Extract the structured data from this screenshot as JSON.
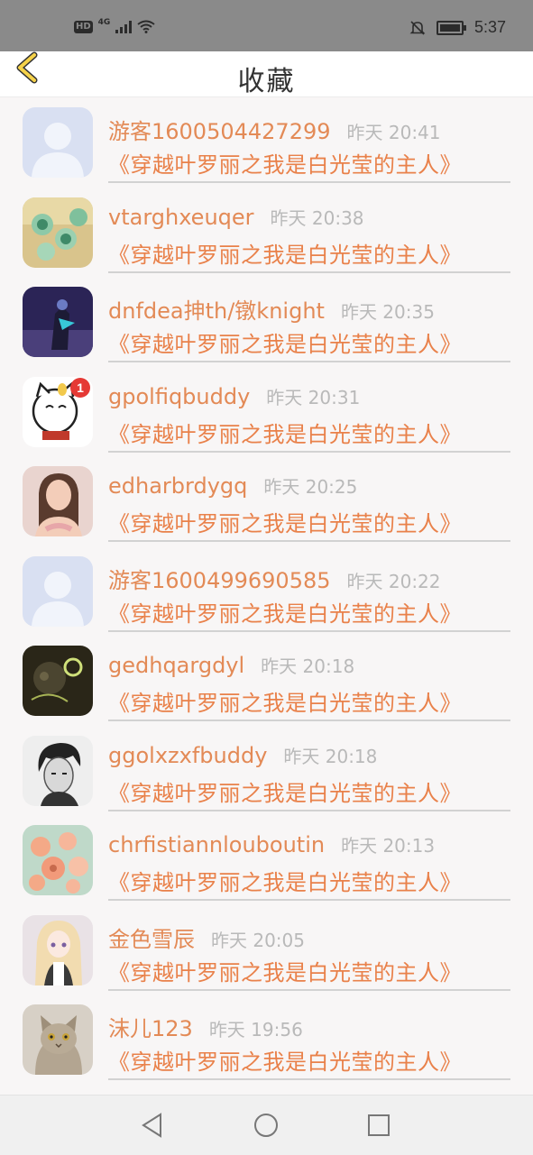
{
  "status_bar": {
    "hd": "HD",
    "signal": "4G",
    "time": "5:37",
    "battery_level": 0.85
  },
  "header": {
    "title": "收藏",
    "back_icon": "chevron-left-icon"
  },
  "favorites": [
    {
      "username": "游客1600504427299",
      "time": "昨天 20:41",
      "book": "《穿越叶罗丽之我是白光莹的主人》",
      "avatar": "default-avatar"
    },
    {
      "username": "vtarghxeuqer",
      "time": "昨天 20:38",
      "book": "《穿越叶罗丽之我是白光莹的主人》",
      "avatar": "cakes-avatar"
    },
    {
      "username": "dnfdea抻th/镦knight",
      "time": "昨天 20:35",
      "book": "《穿越叶罗丽之我是白光莹的主人》",
      "avatar": "knight-avatar"
    },
    {
      "username": "gpolfiqbuddy",
      "time": "昨天 20:31",
      "book": "《穿越叶罗丽之我是白光莹的主人》",
      "avatar": "lucky-cat-avatar"
    },
    {
      "username": "edharbrdygq",
      "time": "昨天 20:25",
      "book": "《穿越叶罗丽之我是白光莹的主人》",
      "avatar": "woman-avatar"
    },
    {
      "username": "游客1600499690585",
      "time": "昨天 20:22",
      "book": "《穿越叶罗丽之我是白光莹的主人》",
      "avatar": "default-avatar"
    },
    {
      "username": "gedhqargdyl",
      "time": "昨天 20:18",
      "book": "《穿越叶罗丽之我是白光莹的主人》",
      "avatar": "dark-photo-avatar"
    },
    {
      "username": "ggolxzxfbuddy",
      "time": "昨天 20:18",
      "book": "《穿越叶罗丽之我是白光莹的主人》",
      "avatar": "man-sketch-avatar"
    },
    {
      "username": "chrfistiannlouboutin",
      "time": "昨天 20:13",
      "book": "《穿越叶罗丽之我是白光莹的主人》",
      "avatar": "flowers-avatar"
    },
    {
      "username": "金色雪辰",
      "time": "昨天 20:05",
      "book": "《穿越叶罗丽之我是白光莹的主人》",
      "avatar": "anime-girl-avatar"
    },
    {
      "username": "沫儿123",
      "time": "昨天 19:56",
      "book": "《穿越叶罗丽之我是白光莹的主人》",
      "avatar": "cat-avatar"
    }
  ],
  "navbar": {
    "back": "triangle-back-icon",
    "home": "circle-home-icon",
    "recents": "square-recents-icon"
  },
  "colors": {
    "accent": "#e38a56",
    "timestamp": "#b9b9b9",
    "back_arrow": "#f5d24a"
  }
}
